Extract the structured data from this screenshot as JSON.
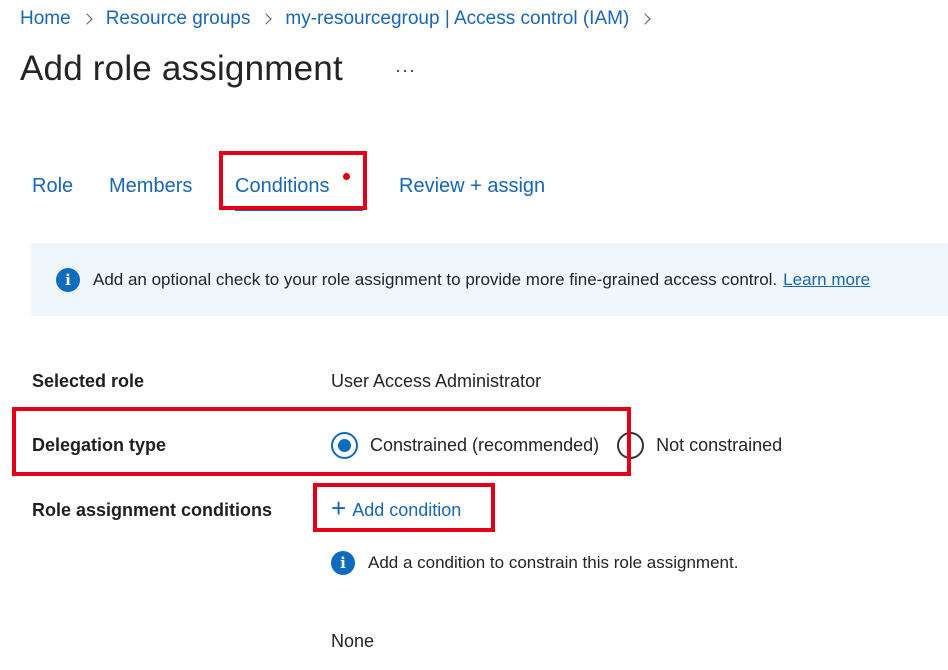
{
  "breadcrumb": {
    "items": [
      "Home",
      "Resource groups",
      "my-resourcegroup | Access control (IAM)"
    ]
  },
  "page": {
    "title": "Add role assignment",
    "more_icon": "···"
  },
  "tabs": {
    "role": "Role",
    "members": "Members",
    "conditions": "Conditions",
    "review": "Review + assign",
    "selected": "Conditions"
  },
  "info": {
    "icon": "i",
    "text": "Add an optional check to your role assignment to provide more fine-grained access control.",
    "link": "Learn more"
  },
  "form": {
    "selected_role_label": "Selected role",
    "selected_role_value": "User Access Administrator",
    "delegation_label": "Delegation type",
    "delegation_options": [
      "Constrained (recommended)",
      "Not constrained"
    ],
    "delegation_selected": "Constrained (recommended)",
    "conditions_label": "Role assignment conditions",
    "add_condition": "Add condition",
    "add_condition_icon": "+",
    "condition_note": "Add a condition to constrain this role assignment.",
    "conditions_value": "None"
  },
  "colors": {
    "accent": "#0f6cbd",
    "link": "#1866b4",
    "highlight": "#e5001a",
    "info_background": "#eff6fc"
  }
}
